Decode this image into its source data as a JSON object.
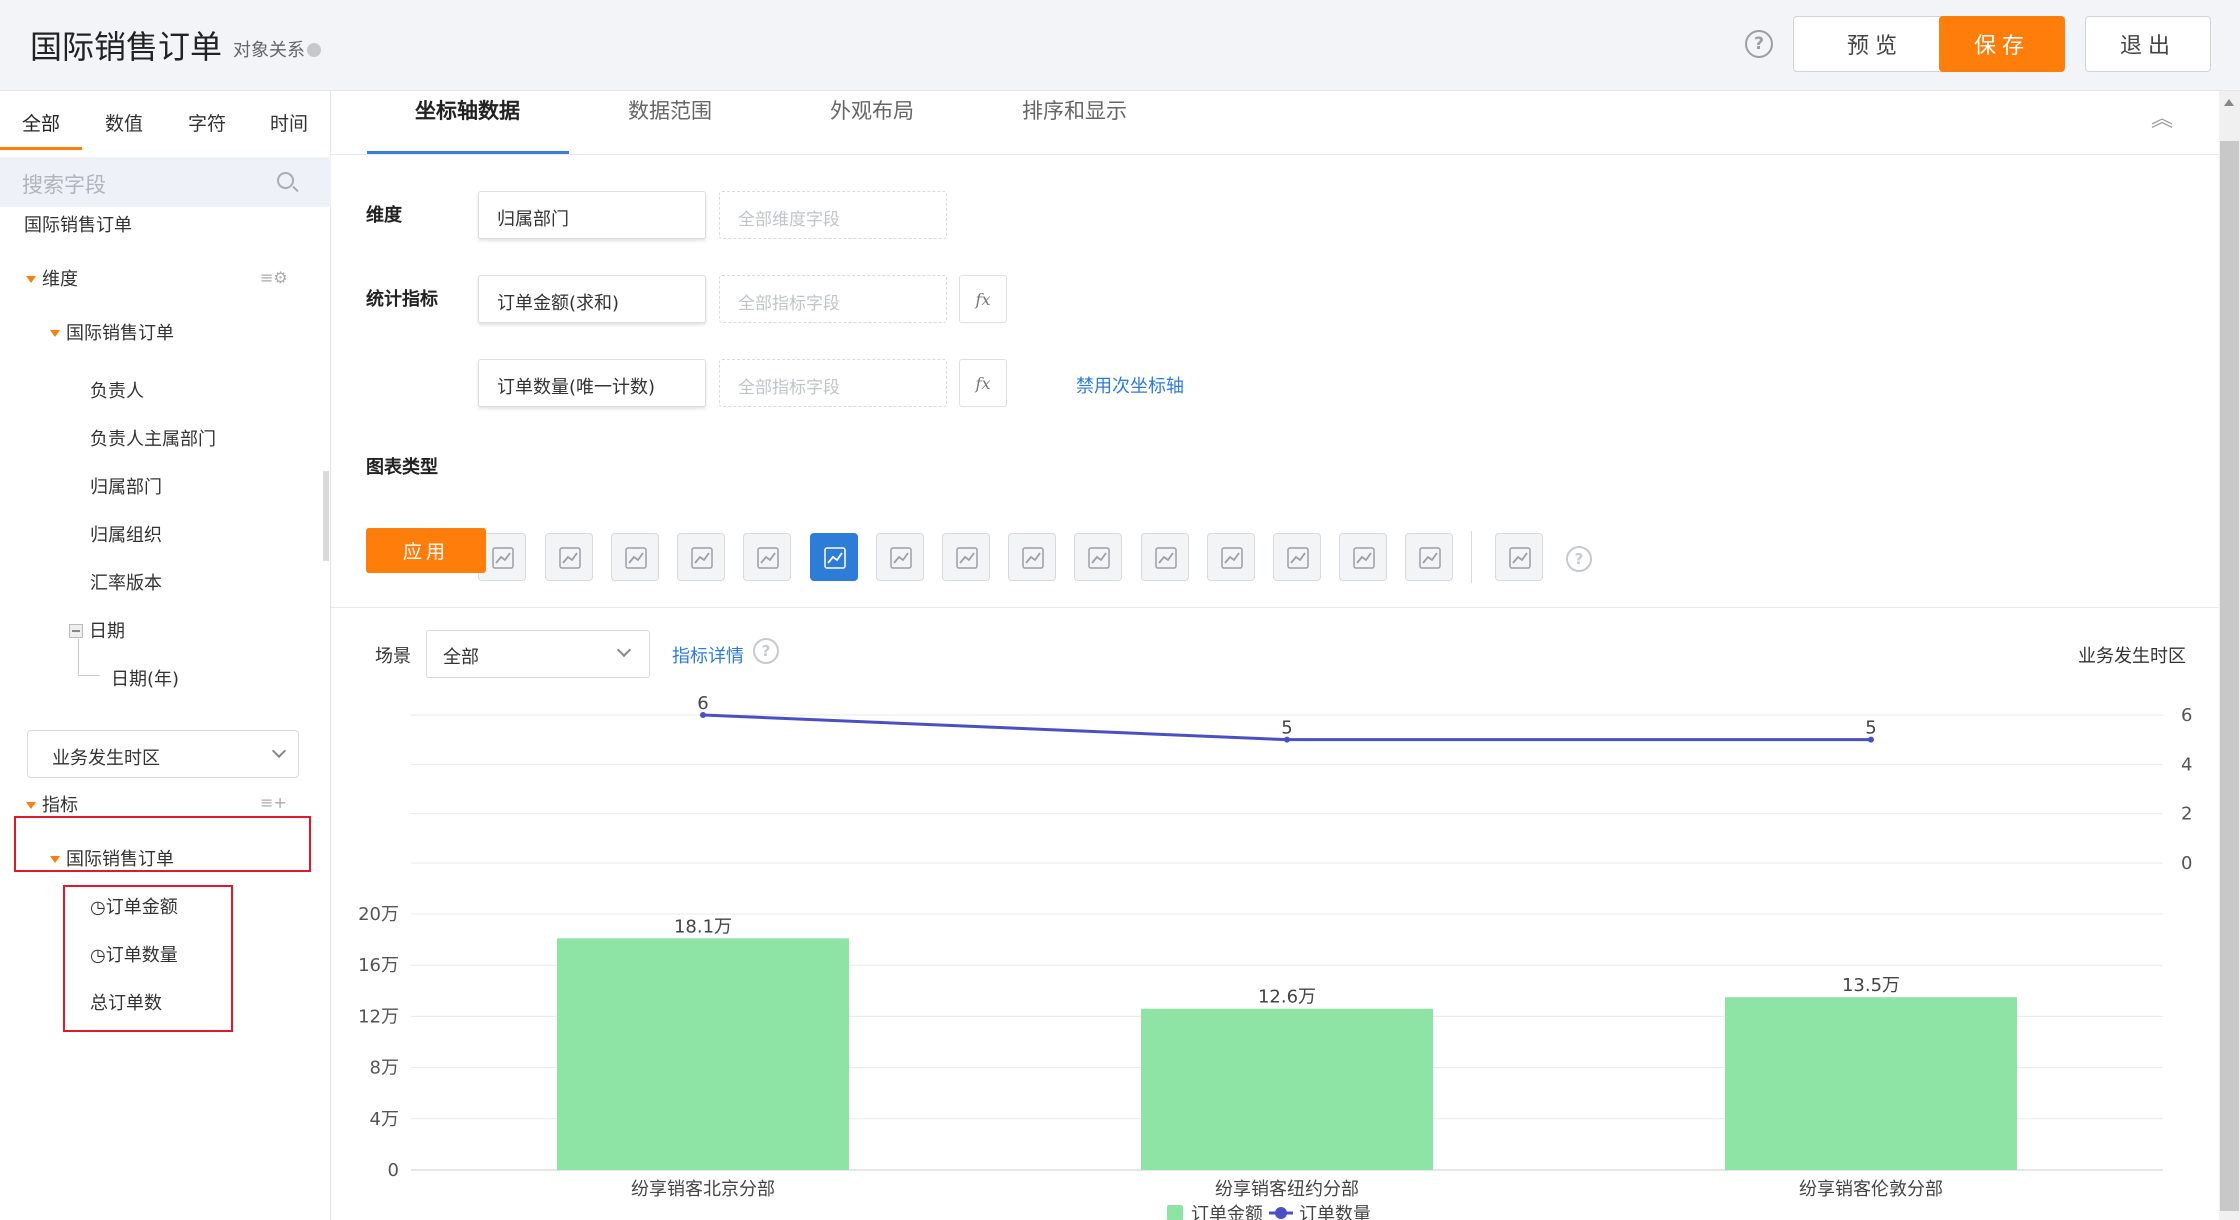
{
  "header": {
    "title": "国际销售订单",
    "relation_link": "对象关系",
    "preview": "预览",
    "save": "保存",
    "exit": "退出"
  },
  "sidebar": {
    "filter_tabs": [
      "全部",
      "数值",
      "字符",
      "时间"
    ],
    "search_placeholder": "搜索字段",
    "object_name": "国际销售订单",
    "dimension_group": "维度",
    "dimension_object": "国际销售订单",
    "dimension_fields": [
      "负责人",
      "负责人主属部门",
      "归属部门",
      "归属组织",
      "汇率版本"
    ],
    "date_group": "日期",
    "date_child": "日期(年)",
    "timezone_select": "业务发生时区",
    "metric_group": "指标",
    "metric_object": "国际销售订单",
    "metric_fields": [
      "订单金额",
      "订单数量",
      "总订单数"
    ]
  },
  "tabs": [
    "坐标轴数据",
    "数据范围",
    "外观布局",
    "排序和显示"
  ],
  "config": {
    "dimension_label": "维度",
    "dimension_value": "归属部门",
    "dimension_placeholder": "全部维度字段",
    "metric_label": "统计指标",
    "metric1_value": "订单金额(求和)",
    "metric2_value": "订单数量(唯一计数)",
    "metric_placeholder": "全部指标字段",
    "fx_label": "fx",
    "disable_secondary_axis": "禁用次坐标轴",
    "chart_type_label": "图表类型",
    "chart_type_icons": [
      "bar-chart-icon",
      "line-chart-icon",
      "pie-chart-icon",
      "funnel-chart-icon",
      "table-chart-icon",
      "combo-chart-icon",
      "text-card-icon",
      "gauge-chart-icon",
      "map-chart-icon",
      "map2-chart-icon",
      "globe-chart-icon",
      "stacked-bar-icon",
      "area-chart-icon",
      "heatmap-icon",
      "pivot-table-icon",
      "scatter-chart-icon"
    ],
    "apply_label": "应用"
  },
  "chart_toolbar": {
    "scene_label": "场景",
    "scene_value": "全部",
    "metric_detail": "指标详情",
    "timezone_label": "业务发生时区"
  },
  "chart_data": {
    "type": "bar",
    "categories": [
      "纷享销客北京分部",
      "纷享销客纽约分部",
      "纷享销客伦敦分部"
    ],
    "series": [
      {
        "name": "订单金额",
        "type": "bar",
        "values": [
          181000,
          126000,
          135000
        ],
        "labels": [
          "18.1万",
          "12.6万",
          "13.5万"
        ],
        "color": "#8ee4a4"
      },
      {
        "name": "订单数量",
        "type": "line",
        "values": [
          6,
          5,
          5
        ],
        "labels": [
          "6",
          "5",
          "5"
        ],
        "color": "#4b4fc4"
      }
    ],
    "bar_axis": {
      "ticks": [
        "0",
        "4万",
        "8万",
        "12万",
        "16万",
        "20万"
      ],
      "ylim": [
        0,
        200000
      ]
    },
    "line_axis": {
      "ticks": [
        "0",
        "2",
        "4",
        "6"
      ],
      "ylim": [
        0,
        6
      ]
    },
    "legend": "bottom-center",
    "grid": true
  }
}
